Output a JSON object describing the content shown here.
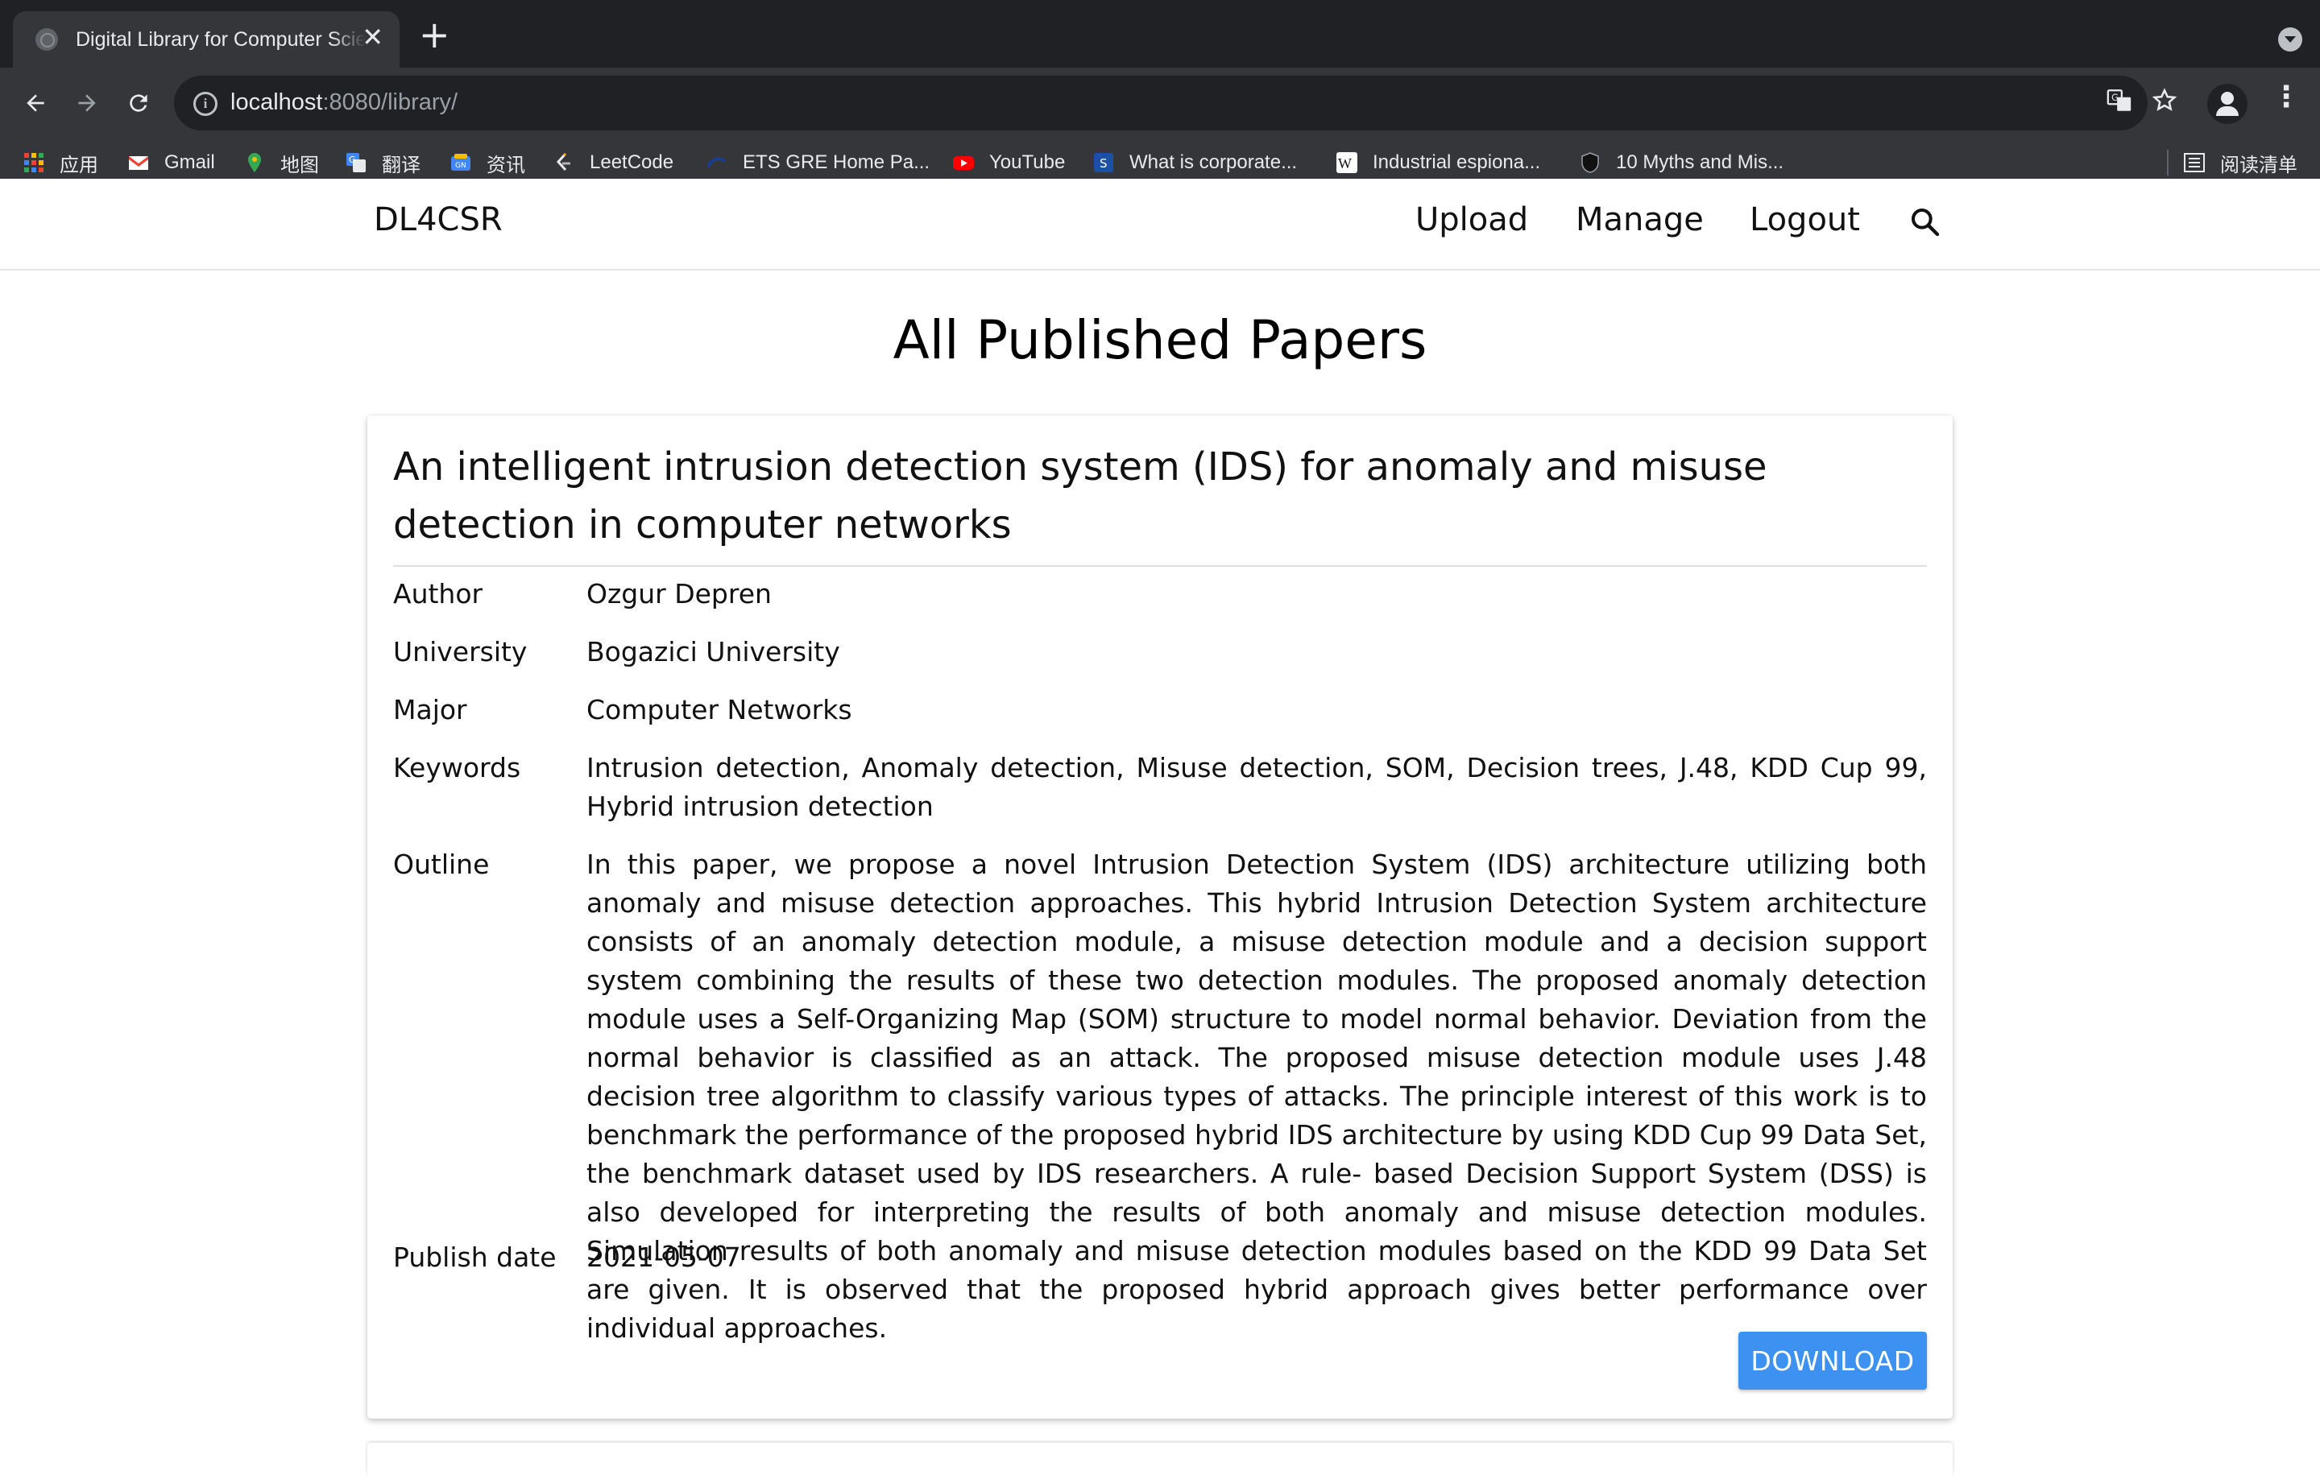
{
  "browser": {
    "tab_title": "Digital Library for Computer Science Research",
    "tab_close": "✕",
    "new_tab": "+",
    "url_host": "localhost",
    "url_path": ":8080/library/",
    "bookmarks": [
      {
        "label": "应用",
        "icon": "apps-grid-icon"
      },
      {
        "label": "Gmail",
        "icon": "gmail-icon"
      },
      {
        "label": "地图",
        "icon": "maps-pin-icon"
      },
      {
        "label": "翻译",
        "icon": "translate-icon"
      },
      {
        "label": "资讯",
        "icon": "news-icon"
      },
      {
        "label": "LeetCode",
        "icon": "leetcode-icon"
      },
      {
        "label": "ETS GRE Home Pa...",
        "icon": "ets-icon"
      },
      {
        "label": "YouTube",
        "icon": "youtube-icon"
      },
      {
        "label": "What is corporate...",
        "icon": "scribd-icon"
      },
      {
        "label": "Industrial espiona...",
        "icon": "wikipedia-icon"
      },
      {
        "label": "10 Myths and Mis...",
        "icon": "shield-icon"
      }
    ],
    "reading_list": "阅读清单"
  },
  "navbar": {
    "brand": "DL4CSR",
    "links": [
      "Upload",
      "Manage",
      "Logout"
    ]
  },
  "page": {
    "title": "All Published Papers"
  },
  "paper": {
    "title": "An intelligent intrusion detection system (IDS) for anomaly and misuse detection in computer networks",
    "fields": [
      {
        "label": "Author",
        "value": "Ozgur Depren"
      },
      {
        "label": "University",
        "value": "Bogazici University"
      },
      {
        "label": "Major",
        "value": "Computer Networks"
      },
      {
        "label": "Keywords",
        "value": "Intrusion detection, Anomaly detection, Misuse detection, SOM, Decision trees, J.48, KDD Cup 99, Hybrid intrusion detection"
      },
      {
        "label": "Outline",
        "value": "In this paper, we propose a novel Intrusion Detection System (IDS) architecture utilizing both anomaly and misuse detection approaches. This hybrid Intrusion Detection System architecture consists of an anomaly detection module, a misuse detection module and a decision support system combining the results of these two detection modules. The proposed anomaly detection module uses a Self-Organizing Map (SOM) structure to model normal behavior. Deviation from the normal behavior is classified as an attack. The proposed misuse detection module uses J.48 decision tree algorithm to classify various types of attacks. The principle interest of this work is to benchmark the performance of the proposed hybrid IDS architecture by using KDD Cup 99 Data Set, the benchmark dataset used by IDS researchers. A rule- based Decision Support System (DSS) is also developed for interpreting the results of both anomaly and misuse detection modules. Simulation results of both anomaly and misuse detection modules based on the KDD 99 Data Set are given. It is observed that the proposed hybrid approach gives better performance over individual approaches."
      },
      {
        "label": "Publish date",
        "value": "2021-05-07"
      }
    ],
    "download_label": "DOWNLOAD"
  },
  "colors": {
    "accent": "#3d91f0",
    "chrome_dark": "#202124",
    "chrome_toolbar": "#35363a"
  }
}
